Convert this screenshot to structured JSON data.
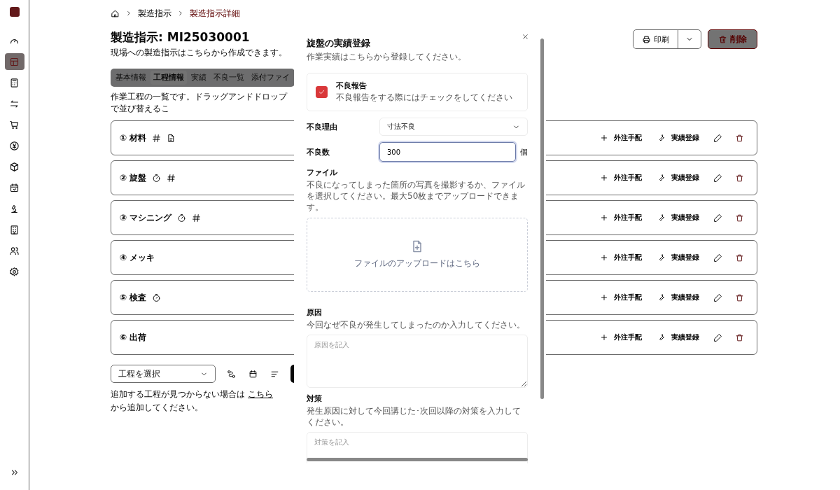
{
  "sidebar": {
    "items": [
      {
        "kind": "gauge",
        "selected": false
      },
      {
        "kind": "table",
        "selected": true
      },
      {
        "kind": "calculator",
        "selected": false
      },
      {
        "kind": "transfer",
        "selected": false
      },
      {
        "kind": "cart",
        "selected": false
      },
      {
        "kind": "yen",
        "selected": false
      },
      {
        "kind": "package",
        "selected": false
      },
      {
        "kind": "calendar",
        "selected": false
      },
      {
        "kind": "microscope",
        "selected": false
      },
      {
        "kind": "building",
        "selected": false
      },
      {
        "kind": "users",
        "selected": false
      },
      {
        "kind": "settings",
        "selected": false
      }
    ]
  },
  "breadcrumb": [
    {
      "label": "製造指示",
      "selected": false
    },
    {
      "label": "製造指示詳細",
      "selected": true
    }
  ],
  "page": {
    "title": "製造指示: MI25030001",
    "subtitle": "現場への製造指示はこちらから作成できます。"
  },
  "header_actions": {
    "print": "印刷",
    "delete": "削除"
  },
  "tabs": [
    {
      "label": "基本情報",
      "selected": false
    },
    {
      "label": "工程情報",
      "selected": true
    },
    {
      "label": "実績",
      "selected": false
    },
    {
      "label": "不良一覧",
      "selected": false
    },
    {
      "label": "添付ファイ",
      "selected": false
    }
  ],
  "process_description": "作業工程の一覧です。ドラッグアンドドロップで並び替えるこ",
  "processes": [
    {
      "label": "① 材料",
      "markers": [
        {
          "kind": "hash"
        },
        {
          "kind": "file"
        }
      ],
      "outsource": "外注手配",
      "record": "実績登録"
    },
    {
      "label": "② 旋盤",
      "markers": [
        {
          "kind": "timer"
        },
        {
          "kind": "hash"
        }
      ],
      "outsource": "外注手配",
      "record": "実績登録"
    },
    {
      "label": "③ マシニング",
      "markers": [
        {
          "kind": "timer"
        },
        {
          "kind": "hash"
        }
      ],
      "outsource": "外注手配",
      "record": "実績登録"
    },
    {
      "label": "④ メッキ",
      "outsource": "外注手配",
      "record": "実績登録"
    },
    {
      "label": "⑤ 検査",
      "markers": [
        {
          "kind": "timer"
        }
      ],
      "outsource": "外注手配",
      "record": "実績登録"
    },
    {
      "label": "⑥ 出荷",
      "outsource": "外注手配",
      "record": "実績登録"
    }
  ],
  "add_process": {
    "placeholder": "工程を選択",
    "help_before": "追加する工程が見つからない場合は",
    "help_link": "こちら",
    "help_after": "から追加してください。"
  },
  "dialog": {
    "title": "旋盤の実績登録",
    "subtitle": "作業実績はこちらから登録してください。",
    "defect_report": {
      "label": "不良報告",
      "description": "不良報告をする際にはチェックをしてください",
      "checked": true
    },
    "reason": {
      "label": "不良理由",
      "value": "寸法不良"
    },
    "count": {
      "label": "不良数",
      "value": "300",
      "unit": "個"
    },
    "file": {
      "label": "ファイル",
      "description": "不良になってしまった箇所の写真を撮影するか、ファイルを選択してください。最大50枚までアップロードできます。",
      "dropzone": "ファイルのアップロードはこちら"
    },
    "cause": {
      "label": "原因",
      "description": "今回なぜ不良が発生してしまったのか入力してください。",
      "placeholder": "原因を記入"
    },
    "countermeasure": {
      "label": "対策",
      "description": "発生原因に対して今回講じた･次回以降の対策を入力してください。",
      "placeholder": "対策を記入"
    }
  }
}
